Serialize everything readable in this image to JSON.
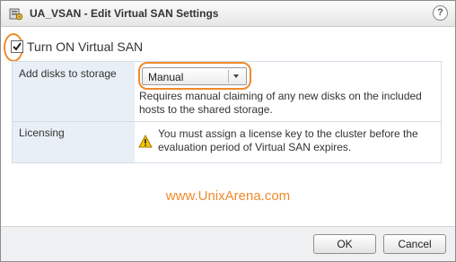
{
  "window": {
    "title": "UA_VSAN - Edit Virtual SAN Settings",
    "help_icon": "help-icon",
    "title_icon": "cluster-settings-icon"
  },
  "vsan": {
    "enabled": true,
    "label": "Turn ON Virtual SAN"
  },
  "settings": {
    "add_disks": {
      "label": "Add disks to storage",
      "selected": "Manual",
      "description": "Requires manual claiming of any new disks on the included hosts to the shared storage."
    },
    "licensing": {
      "label": "Licensing",
      "warning": "You must assign a license key to the cluster before the evaluation period of Virtual SAN expires.",
      "icon": "warning-icon"
    }
  },
  "watermark": "www.UnixArena.com",
  "buttons": {
    "ok": "OK",
    "cancel": "Cancel"
  },
  "colors": {
    "highlight": "#f08a2b",
    "label_column_bg": "#e9eff6",
    "footer_bg": "#eef0f2"
  }
}
